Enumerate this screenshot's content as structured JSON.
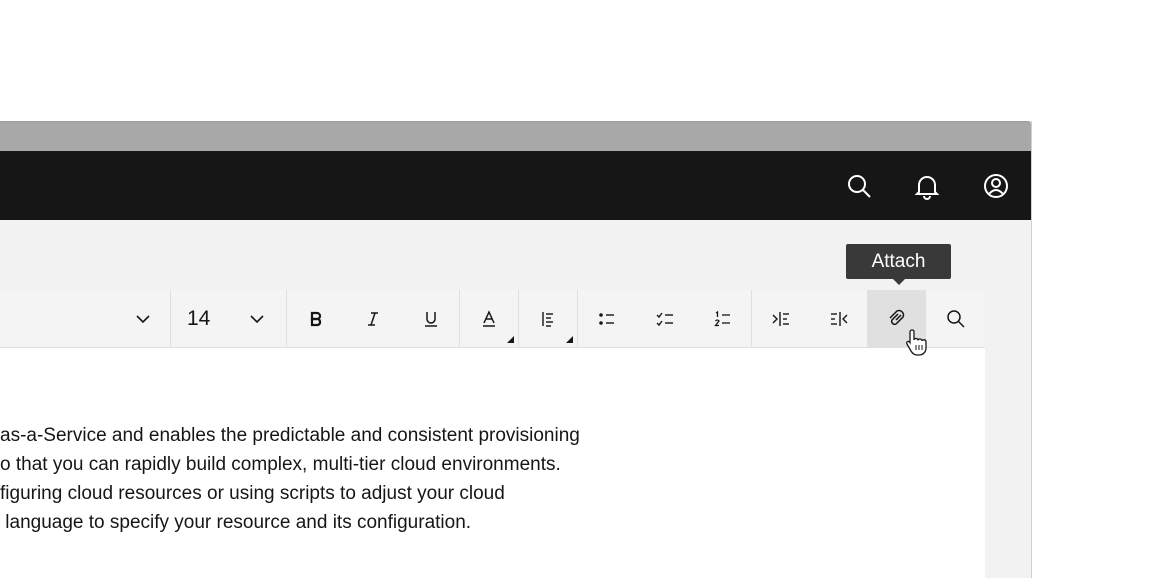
{
  "header": {
    "icons": [
      "search-icon",
      "notification-icon",
      "user-avatar-icon"
    ]
  },
  "toolbar": {
    "font_size": "14",
    "buttons": [
      {
        "name": "bold",
        "icon": "bold-icon"
      },
      {
        "name": "italic",
        "icon": "italic-icon"
      },
      {
        "name": "underline",
        "icon": "underline-icon"
      },
      {
        "name": "text-color",
        "icon": "text-color-icon"
      },
      {
        "name": "align",
        "icon": "align-left-icon"
      },
      {
        "name": "bulleted-list",
        "icon": "bulleted-list-icon"
      },
      {
        "name": "checklist",
        "icon": "checklist-icon"
      },
      {
        "name": "numbered-list",
        "icon": "numbered-list-icon"
      },
      {
        "name": "indent",
        "icon": "indent-icon"
      },
      {
        "name": "outdent",
        "icon": "outdent-icon"
      },
      {
        "name": "attach",
        "icon": "attach-icon",
        "state": "hovered"
      },
      {
        "name": "find",
        "icon": "search-icon"
      }
    ]
  },
  "tooltip": {
    "label": "Attach"
  },
  "document": {
    "lines": [
      "as-a-Service and enables the predictable and consistent provisioning",
      "o that you can rapidly build complex, multi-tier cloud environments.",
      "figuring cloud resources or using scripts to adjust your cloud",
      " language to specify your resource and its configuration."
    ]
  },
  "colors": {
    "header_bg": "#161616",
    "toolbar_bg": "#f4f4f4",
    "hover_bg": "#e0e0e0",
    "tooltip_bg": "#393939"
  }
}
